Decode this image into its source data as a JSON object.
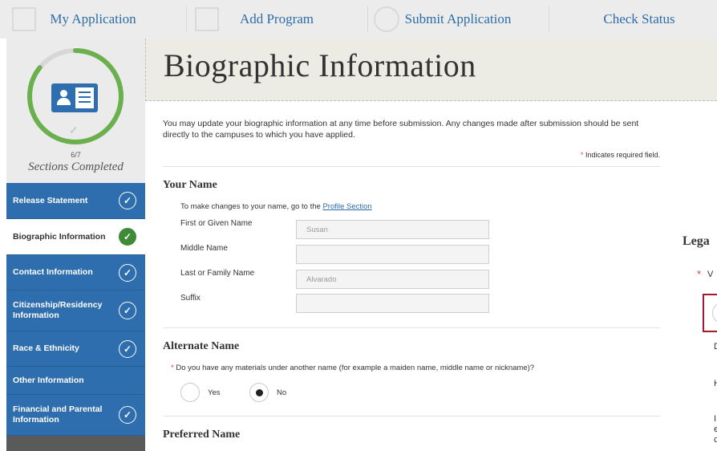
{
  "topnav": {
    "tabs": [
      "My Application",
      "Add Program",
      "Submit Application",
      "Check Status"
    ]
  },
  "progress": {
    "count": "6/7",
    "caption": "Sections Completed",
    "completed": 6,
    "total": 7
  },
  "sidebar": {
    "items": [
      {
        "label": "Release Statement",
        "checked": true,
        "active": false
      },
      {
        "label": "Biographic Information",
        "checked": true,
        "active": true
      },
      {
        "label": "Contact Information",
        "checked": true,
        "active": false
      },
      {
        "label": "Citizenship/Residency Information",
        "checked": true,
        "active": false
      },
      {
        "label": "Race & Ethnicity",
        "checked": true,
        "active": false
      },
      {
        "label": "Other Information",
        "checked": false,
        "active": false
      },
      {
        "label": "Financial and Parental Information",
        "checked": true,
        "active": false
      }
    ],
    "check_glyph": "✓"
  },
  "page": {
    "title": "Biographic Information",
    "intro": "You may update your biographic information at any time before submission. Any changes made after submission should be sent directly to the campuses to which you have applied.",
    "required_star": "*",
    "required_note": "Indicates required field."
  },
  "your_name": {
    "title": "Your Name",
    "hint": "To make changes to your name, go to the",
    "hint_link": "Profile Section",
    "fields": [
      {
        "label": "First or Given Name",
        "value": "Susan"
      },
      {
        "label": "Middle Name",
        "value": ""
      },
      {
        "label": "Last or Family Name",
        "value": "Alvarado"
      },
      {
        "label": "Suffix",
        "value": ""
      }
    ]
  },
  "alternate_name": {
    "title": "Alternate Name",
    "question": "Do you have any materials under another name (for example a maiden name, middle name or nickname)?",
    "options": [
      "Yes",
      "No"
    ],
    "selected": "No"
  },
  "preferred_name": {
    "title": "Preferred Name"
  },
  "right_panel": {
    "title_fragment": "Lega",
    "star": "*",
    "text_fragment": "V",
    "letters": [
      "D",
      "H",
      "I",
      "e",
      "c"
    ]
  },
  "colors": {
    "nav_blue": "#2f6eae",
    "progress_green": "#6ab04c",
    "active_check": "#3d8b37",
    "link": "#2d6ca8",
    "required": "#d64545"
  }
}
